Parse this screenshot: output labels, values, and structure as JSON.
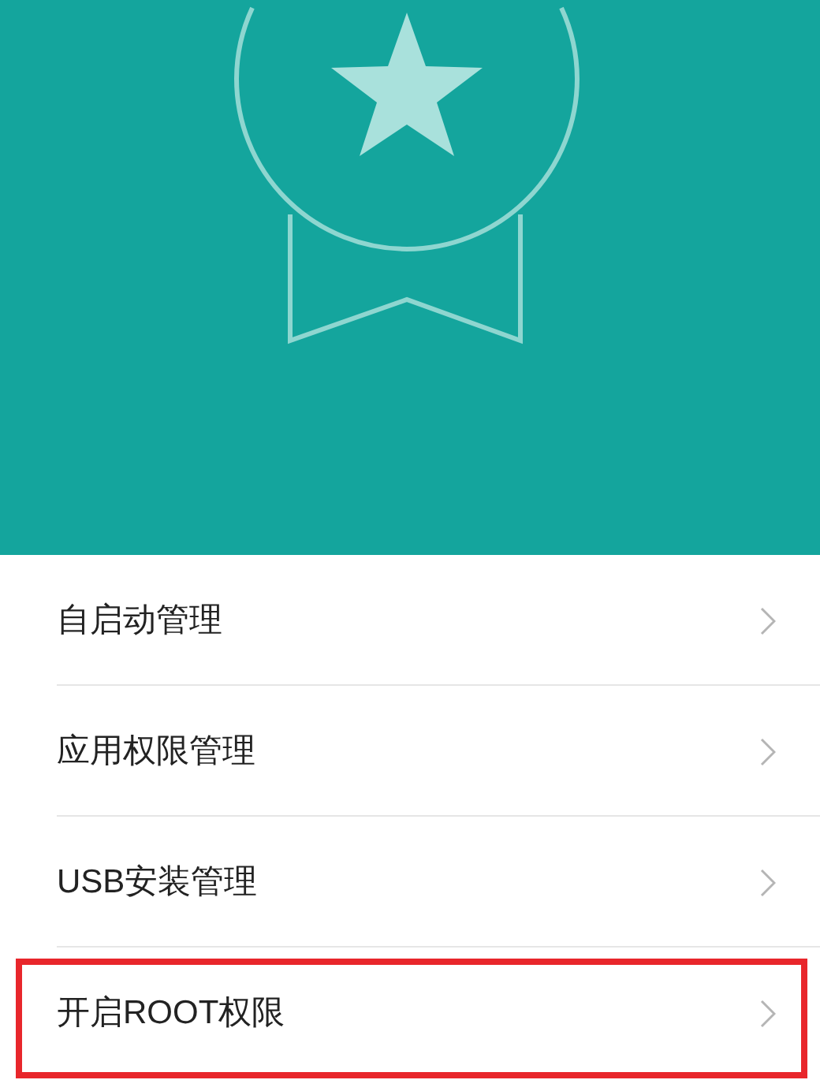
{
  "items": [
    {
      "label": "自启动管理",
      "highlighted": false
    },
    {
      "label": "应用权限管理",
      "highlighted": false
    },
    {
      "label": "USB安装管理",
      "highlighted": false
    },
    {
      "label": "开启ROOT权限",
      "highlighted": true
    }
  ]
}
